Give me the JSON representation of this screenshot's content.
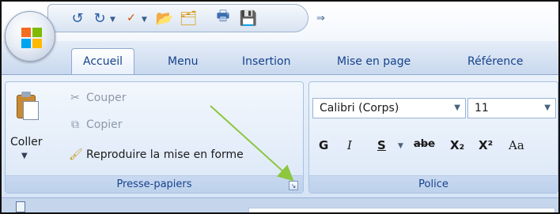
{
  "tabs": [
    {
      "label": "Accueil",
      "active": true
    },
    {
      "label": "Menu"
    },
    {
      "label": "Insertion"
    },
    {
      "label": "Mise en page"
    },
    {
      "label": "Référence"
    }
  ],
  "quick_access": {
    "icons": [
      "undo-icon",
      "redo-icon",
      "spelling-icon",
      "open-folder-icon",
      "new-folder-icon",
      "print-preview-icon",
      "save-icon"
    ],
    "more_glyph": "⇒"
  },
  "clipboard_group": {
    "title": "Presse-papiers",
    "paste_label": "Coller",
    "commands": [
      {
        "label": "Couper",
        "enabled": false
      },
      {
        "label": "Copier",
        "enabled": false
      },
      {
        "label": "Reproduire la mise en forme",
        "enabled": true
      }
    ]
  },
  "font_group": {
    "title": "Police",
    "font_name": "Calibri (Corps)",
    "font_size": "11",
    "format_buttons": [
      "G",
      "I",
      "S",
      "abe",
      "X₂",
      "X²",
      "Aa"
    ]
  },
  "colors": {
    "accent": "#15428b",
    "annotation_arrow": "#8dc63f"
  }
}
